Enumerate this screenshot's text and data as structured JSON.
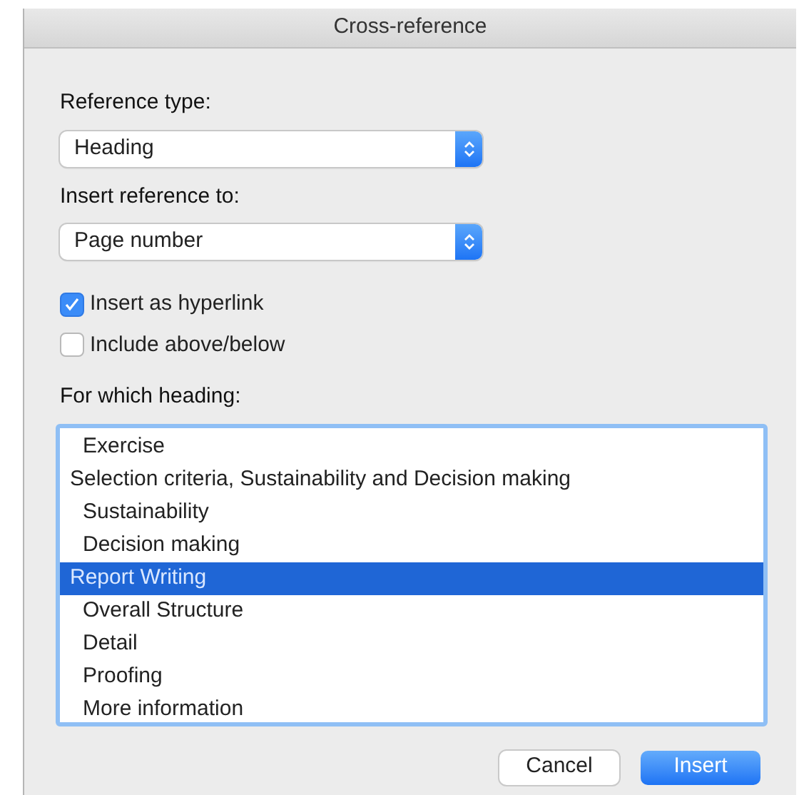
{
  "window": {
    "title": "Cross-reference"
  },
  "reference_type": {
    "label": "Reference type:",
    "value": "Heading"
  },
  "insert_reference_to": {
    "label": "Insert reference to:",
    "value": "Page number"
  },
  "checkboxes": [
    {
      "label": "Insert as hyperlink",
      "checked": true
    },
    {
      "label": "Include above/below",
      "checked": false
    }
  ],
  "headings": {
    "label": "For which heading:",
    "items": [
      {
        "children": [
          {
            "label": "Exercise",
            "selected": false
          }
        ]
      },
      {
        "label": "Selection criteria, Sustainability and Decision making",
        "selected": false,
        "children": [
          {
            "label": "Sustainability",
            "selected": false
          },
          {
            "label": "Decision making",
            "selected": false
          }
        ]
      },
      {
        "label": "Report Writing",
        "selected": true,
        "children": [
          {
            "label": "Overall Structure",
            "selected": false
          },
          {
            "label": "Detail",
            "selected": false
          },
          {
            "label": "Proofing",
            "selected": false
          },
          {
            "label": "More information",
            "selected": false
          }
        ]
      }
    ]
  },
  "buttons": [
    {
      "label": "Cancel",
      "kind": "secondary"
    },
    {
      "label": "Insert",
      "kind": "primary"
    }
  ]
}
